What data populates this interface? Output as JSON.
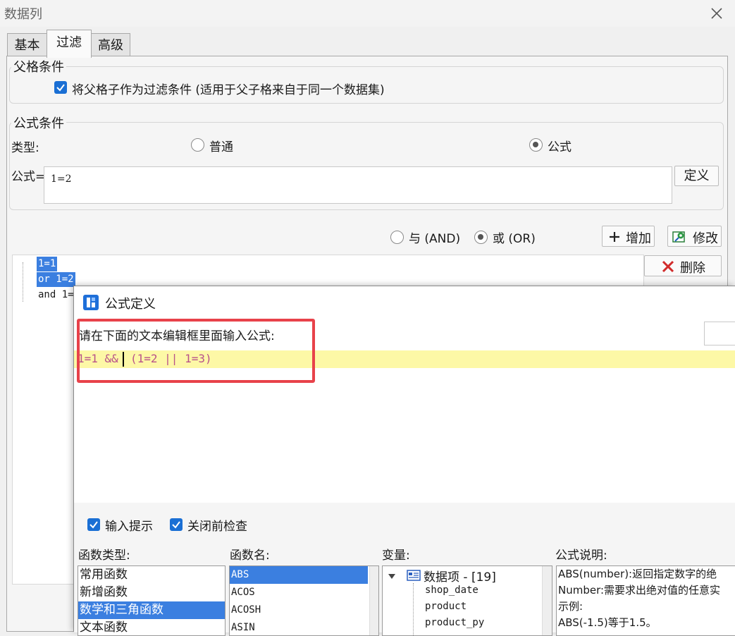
{
  "window": {
    "title": "数据列"
  },
  "tabs": [
    {
      "label": "基本",
      "active": false
    },
    {
      "label": "过滤",
      "active": true
    },
    {
      "label": "高级",
      "active": false
    }
  ],
  "parent_condition": {
    "group_label": "父格条件",
    "checkbox_label": "将父格子作为过滤条件 (适用于父子格来自于同一个数据集)",
    "checked": true
  },
  "formula_condition": {
    "group_label": "公式条件",
    "type_label": "类型:",
    "type_options": [
      {
        "label": "普通",
        "checked": false
      },
      {
        "label": "公式",
        "checked": true
      }
    ],
    "formula_label": "公式=",
    "formula_value": "1=2",
    "define_button": "定义"
  },
  "logic": {
    "options": [
      {
        "label": "与 (AND)",
        "checked": false
      },
      {
        "label": "或 (OR)",
        "checked": true
      }
    ],
    "add_button": "增加",
    "modify_button": "修改",
    "delete_button": "删除"
  },
  "condition_list": [
    {
      "text": "1=1",
      "selected": true
    },
    {
      "text": "or  1=2",
      "selected": true
    },
    {
      "text": "and 1=",
      "selected": false
    }
  ],
  "formula_dialog": {
    "title": "公式定义",
    "prompt": "请在下面的文本编辑框里面输入公式:",
    "formula": {
      "part1": "1=1 &&",
      "part2": "(1=2 || 1=3)"
    },
    "options": [
      {
        "label": "输入提示",
        "checked": true
      },
      {
        "label": "关闭前检查",
        "checked": true
      }
    ],
    "function_types": {
      "label": "函数类型:",
      "items": [
        {
          "text": "常用函数",
          "selected": false
        },
        {
          "text": "新增函数",
          "selected": false
        },
        {
          "text": "数学和三角函数",
          "selected": true
        },
        {
          "text": "文本函数",
          "selected": false
        }
      ]
    },
    "function_names": {
      "label": "函数名:",
      "items": [
        {
          "text": "ABS",
          "selected": true
        },
        {
          "text": "ACOS",
          "selected": false
        },
        {
          "text": "ACOSH",
          "selected": false
        },
        {
          "text": "ASIN",
          "selected": false
        }
      ]
    },
    "variables": {
      "label": "变量:",
      "root": "数据项 - [19]",
      "items": [
        "shop_date",
        "product",
        "product_py"
      ]
    },
    "description": {
      "label": "公式说明:",
      "lines": [
        "ABS(number):返回指定数字的绝",
        "Number:需要求出绝对值的任意实",
        "示例:",
        "ABS(-1.5)等于1.5。"
      ]
    }
  },
  "colors": {
    "accent": "#1a6fd4",
    "selection": "#3b7fe0",
    "highlight_line": "#fdf8a6",
    "formula_text": "#b8528a",
    "annotation": "#e8424a",
    "delete_icon": "#d12b2b"
  }
}
